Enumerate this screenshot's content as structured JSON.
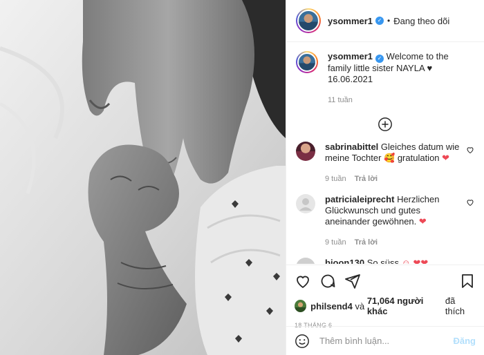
{
  "header": {
    "username": "ysommer1",
    "separator": "•",
    "follow_status": "Đang theo dõi"
  },
  "caption": {
    "username": "ysommer1",
    "text": "Welcome to the family little sister NAYLA ♥ 16.06.2021",
    "time": "11 tuần"
  },
  "comments": [
    {
      "username": "sabrinabittel",
      "text": "Gleiches datum wie meine Tochter 🥰 gratulation",
      "heart": "❤",
      "time": "9 tuần",
      "reply": "Trả lời"
    },
    {
      "username": "patricialeiprecht",
      "text": "Herzlichen Glückwunsch und gutes aneinander gewöhnen.",
      "heart": "❤",
      "time": "9 tuần",
      "reply": "Trả lời"
    },
    {
      "username": "bjoon130",
      "text": "So süss",
      "emojis": "☺ ❤❤"
    }
  ],
  "likes": {
    "first_user": "philsend4",
    "connector": "và",
    "count_text": "71,064 người khác",
    "suffix": "đã thích"
  },
  "post_date": "18 THÁNG 6",
  "add_comment": {
    "placeholder": "Thêm bình luận...",
    "post_label": "Đăng"
  },
  "icons": {
    "like": "heart-icon",
    "comment": "comment-icon",
    "share": "paper-plane-icon",
    "save": "bookmark-icon",
    "emoji": "smiley-icon",
    "more": "plus-circle-icon"
  },
  "colors": {
    "verified": "#3897f0",
    "heart_red": "#ed4956",
    "post_disabled": "#b2dffc",
    "muted": "#8e8e8e"
  }
}
